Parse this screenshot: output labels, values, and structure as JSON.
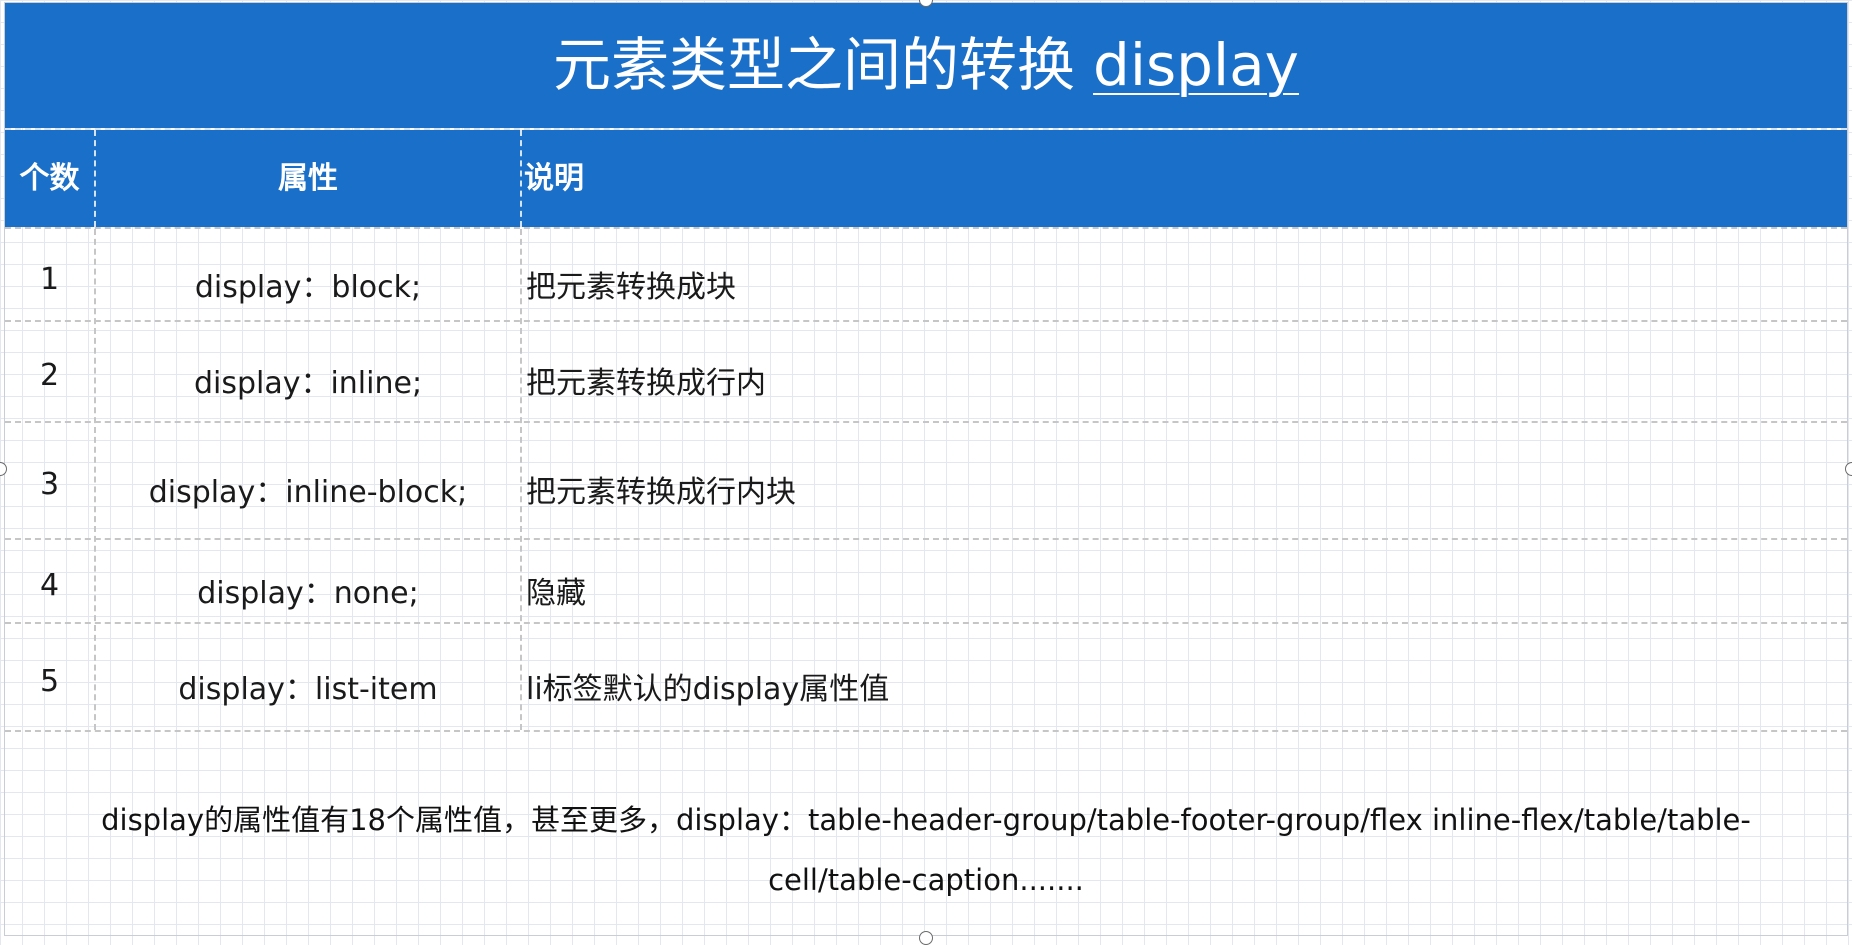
{
  "title": {
    "main": "元素类型之间的转换",
    "keyword": "display"
  },
  "table": {
    "headers": [
      "个数",
      "属性",
      "说明"
    ],
    "rows": [
      {
        "num": "1",
        "prop": "display：block;",
        "desc": "把元素转换成块"
      },
      {
        "num": "2",
        "prop": "display：inline;",
        "desc": "把元素转换成行内"
      },
      {
        "num": "3",
        "prop": "display：inline-block;",
        "desc": "把元素转换成行内块"
      },
      {
        "num": "4",
        "prop": "display：none;",
        "desc": "隐藏"
      },
      {
        "num": "5",
        "prop": "display：list-item",
        "desc": "li标签默认的display属性值"
      }
    ]
  },
  "note": "display的属性值有18个属性值，甚至更多，display：table-header-group/table-footer-group/flex inline-flex/table/table-cell/table-caption......."
}
